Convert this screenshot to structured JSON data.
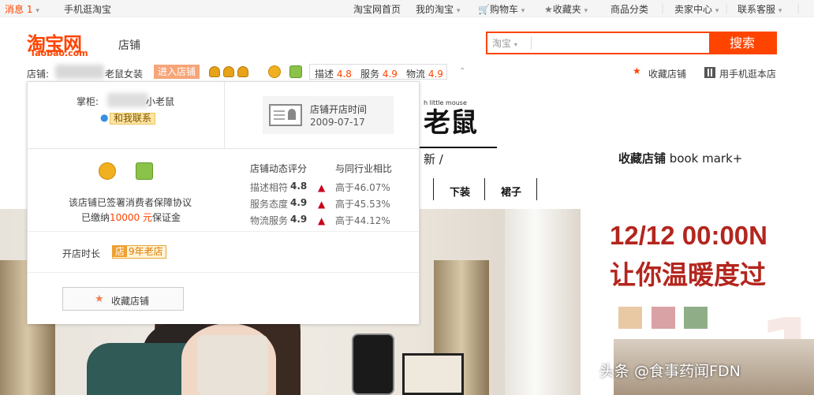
{
  "topnav": {
    "messages": "消息",
    "message_count": "1",
    "mobile": "手机逛淘宝",
    "home": "淘宝网首页",
    "my_taobao": "我的淘宝",
    "cart": "购物车",
    "favorites": "收藏夹",
    "categories": "商品分类",
    "seller_center": "卖家中心",
    "support": "联系客服"
  },
  "header": {
    "logo": "淘宝网",
    "logo_sub": "Taobao.com",
    "store_label": "店铺",
    "search_type": "淘宝",
    "search_button": "搜索",
    "search_placeholder": ""
  },
  "store_row": {
    "store_prefix": "店铺:",
    "store_name": "老鼠女装",
    "enter_store": "进入店铺",
    "ratings": [
      {
        "label": "描述",
        "value": "4.8"
      },
      {
        "label": "服务",
        "value": "4.9"
      },
      {
        "label": "物流",
        "value": "4.9"
      }
    ],
    "favorite_store": "收藏店铺",
    "mobile_store": "用手机逛本店"
  },
  "popup": {
    "owner_label": "掌柜:",
    "owner_name": "小老鼠",
    "contact_button": "和我联系",
    "open_date_label": "店铺开店时间",
    "open_date": "2009-07-17",
    "guarantee_line1": "该店铺已签署消费者保障协议",
    "guarantee_line2_pre": "已缴纳",
    "guarantee_amount": "10000 元",
    "guarantee_line2_post": "保证金",
    "dynamic_header": "店铺动态评分",
    "compare_header": "与同行业相比",
    "scores": [
      {
        "label": "描述相符",
        "value": "4.8",
        "compare": "高于46.07%"
      },
      {
        "label": "服务态度",
        "value": "4.9",
        "compare": "高于45.53%"
      },
      {
        "label": "物流服务",
        "value": "4.9",
        "compare": "高于44.12%"
      }
    ],
    "shop_age_label": "开店时长",
    "shop_age_icon": "店",
    "shop_age_value": "9年老店",
    "favorite_button": "收藏店铺"
  },
  "page": {
    "logo_text": "老鼠",
    "logo_tagline": "h little mouse",
    "new_text": "新 /",
    "bookmark_bold": "收藏店铺",
    "bookmark_rest": "book mark+",
    "nav_items": [
      "下装",
      "裙子"
    ],
    "promo_date": "12/12 00:00N",
    "promo_text": "让你温暖度过",
    "swatch_colors": [
      "#e9c9a4",
      "#d9a2a4",
      "#8fae88"
    ]
  },
  "watermark": "头条 @食事药闻FDN",
  "colors": {
    "accent": "#ff4400",
    "promo_red": "#b3261e"
  }
}
